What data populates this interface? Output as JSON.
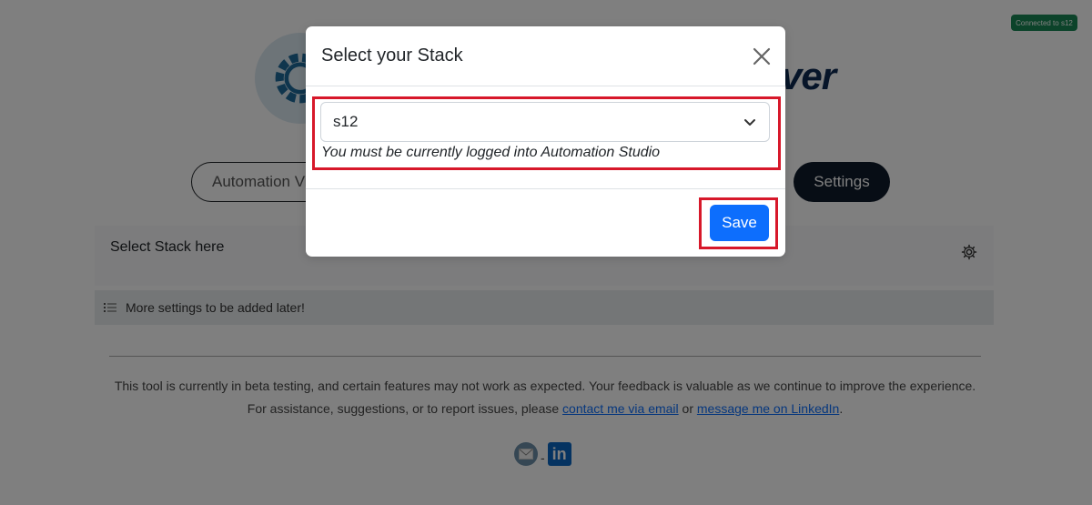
{
  "status_badge": "Connected to s12",
  "header": {
    "title_suffix": "ver"
  },
  "nav": {
    "automation_label": "Automation Vi",
    "settings_label": "Settings"
  },
  "settings": {
    "stack_label": "Select Stack here",
    "more_settings": "More settings to be added later!"
  },
  "footer": {
    "text_before": "This tool is currently in beta testing, and certain features may not work as expected. Your feedback is valuable as we continue to improve the experience. For assistance, suggestions, or to report issues, please ",
    "email_link": "contact me via email",
    "or": " or ",
    "linkedin_link": "message me on LinkedIn",
    "period": ".",
    "separator": "-",
    "linkedin_icon_text": "in"
  },
  "modal": {
    "title": "Select your Stack",
    "selected_value": "s12",
    "helper_text": "You must be currently logged into Automation Studio",
    "save_label": "Save"
  },
  "colors": {
    "primary": "#0d6efd",
    "badge": "#198754",
    "highlight": "#d7182a",
    "dark_button": "#0f1a2a"
  }
}
